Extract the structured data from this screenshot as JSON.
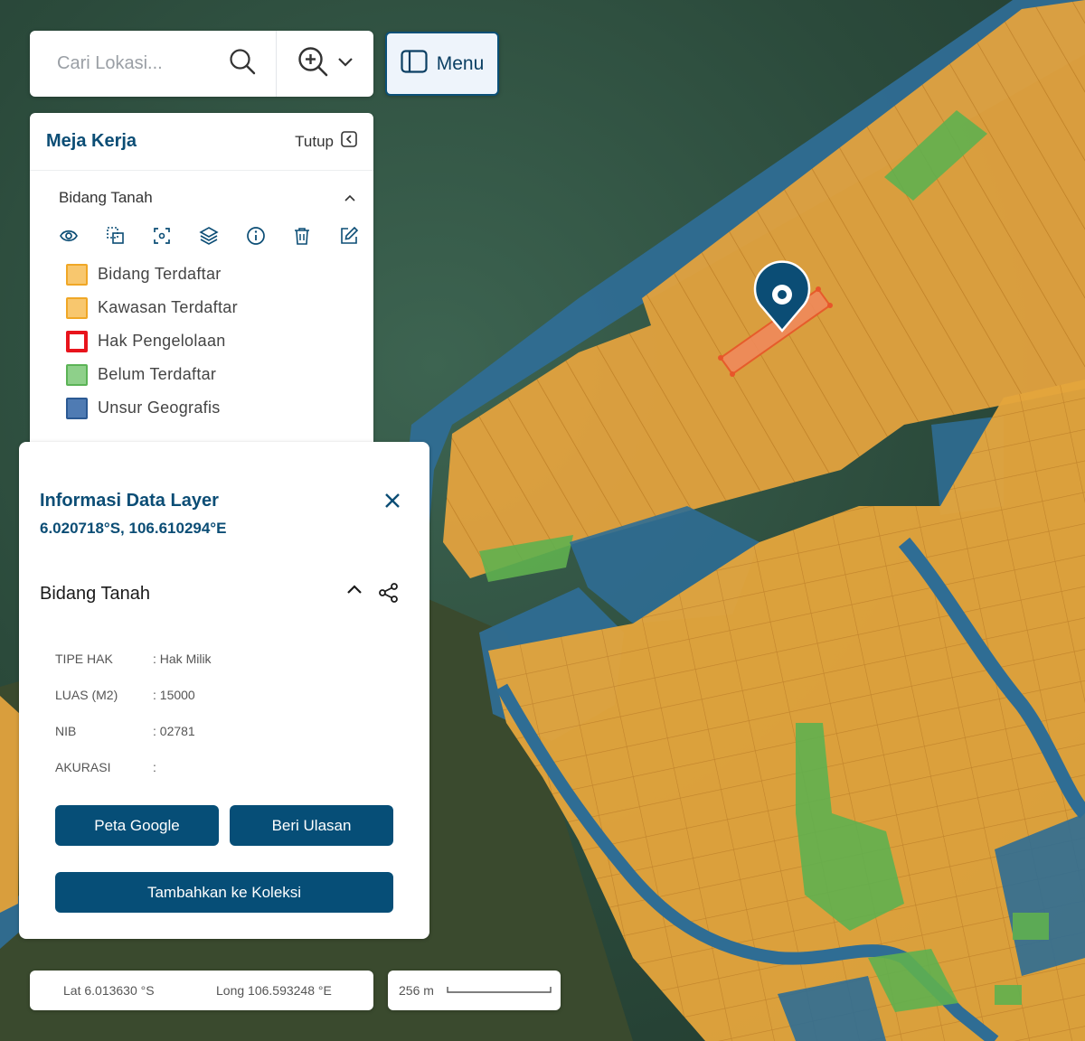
{
  "search": {
    "placeholder": "Cari Lokasi..."
  },
  "menu_button": {
    "label": "Menu"
  },
  "workspace": {
    "title": "Meja Kerja",
    "close_label": "Tutup",
    "layer_title": "Bidang Tanah",
    "tools": [
      "eye-icon",
      "copy-icon",
      "focus-icon",
      "layers-icon",
      "info-icon",
      "trash-icon",
      "edit-icon"
    ],
    "legend": [
      {
        "label": "Bidang Terdaftar",
        "fill": "#f8c76e",
        "border": "#f0a726"
      },
      {
        "label": "Kawasan Terdaftar",
        "fill": "#f8c76e",
        "border": "#f0a726"
      },
      {
        "label": "Hak Pengelolaan",
        "fill": "#ffffff",
        "border": "#e8141c"
      },
      {
        "label": "Belum Terdaftar",
        "fill": "#8ed08a",
        "border": "#5bb356"
      },
      {
        "label": "Unsur Geografis",
        "fill": "#4f7bb3",
        "border": "#2b5993"
      }
    ]
  },
  "info_panel": {
    "title": "Informasi Data Layer",
    "coordinates": "6.020718°S, 106.610294°E",
    "section_title": "Bidang Tanah",
    "attributes": [
      {
        "key": "TIPE HAK",
        "value": ": Hak Milik"
      },
      {
        "key": "LUAS (M2)",
        "value": ": 15000"
      },
      {
        "key": "NIB",
        "value": ": 02781"
      },
      {
        "key": "AKURASI",
        "value": ":"
      }
    ],
    "buttons": {
      "google_map": "Peta Google",
      "review": "Beri Ulasan",
      "add_collection": "Tambahkan ke Koleksi"
    }
  },
  "status": {
    "lat": "Lat 6.013630 °S",
    "long": "Long 106.593248 °E",
    "scale": "256 m"
  },
  "colors": {
    "accent": "#064e77",
    "parcel": "#e8a53a",
    "geographic": "#2f6d94",
    "unregistered": "#6cc05a",
    "sea": "#2e4d40"
  }
}
